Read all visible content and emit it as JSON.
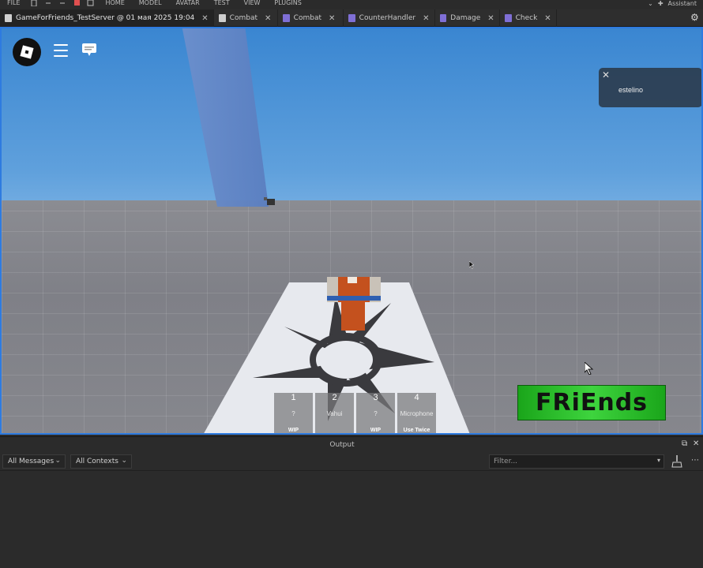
{
  "menubar": {
    "file": "FILE",
    "items": [
      "HOME",
      "MODEL",
      "AVATAR",
      "TEST",
      "VIEW",
      "PLUGINS"
    ],
    "assistant": "Assistant"
  },
  "tabs": [
    {
      "label": "GameForFriends_TestServer @ 01 мая 2025 19:04",
      "icon": "place-icon",
      "active": true
    },
    {
      "label": "Combat",
      "icon": "document-icon",
      "active": false
    },
    {
      "label": "Combat",
      "icon": "script-icon",
      "active": false
    },
    {
      "label": "CounterHandler",
      "icon": "script-icon",
      "active": false
    },
    {
      "label": "Damage",
      "icon": "script-icon",
      "active": false
    },
    {
      "label": "Check",
      "icon": "script-icon",
      "active": false
    }
  ],
  "notification": {
    "text": "estelino"
  },
  "hotbar": [
    {
      "num": "1",
      "name": "?",
      "sub": "WIP"
    },
    {
      "num": "2",
      "name": "Vahui",
      "sub": ""
    },
    {
      "num": "3",
      "name": "?",
      "sub": "WIP"
    },
    {
      "num": "4",
      "name": "Microphone",
      "sub": "Use Twice"
    }
  ],
  "friends_banner": "FRiEnds",
  "output": {
    "title": "Output",
    "messages_filter": "All Messages",
    "contexts_filter": "All Contexts",
    "filter_placeholder": "Filter..."
  },
  "colors": {
    "accent": "#2e7be0",
    "banner_green": "#3ed43e",
    "script_icon": "#7f6fd6"
  }
}
